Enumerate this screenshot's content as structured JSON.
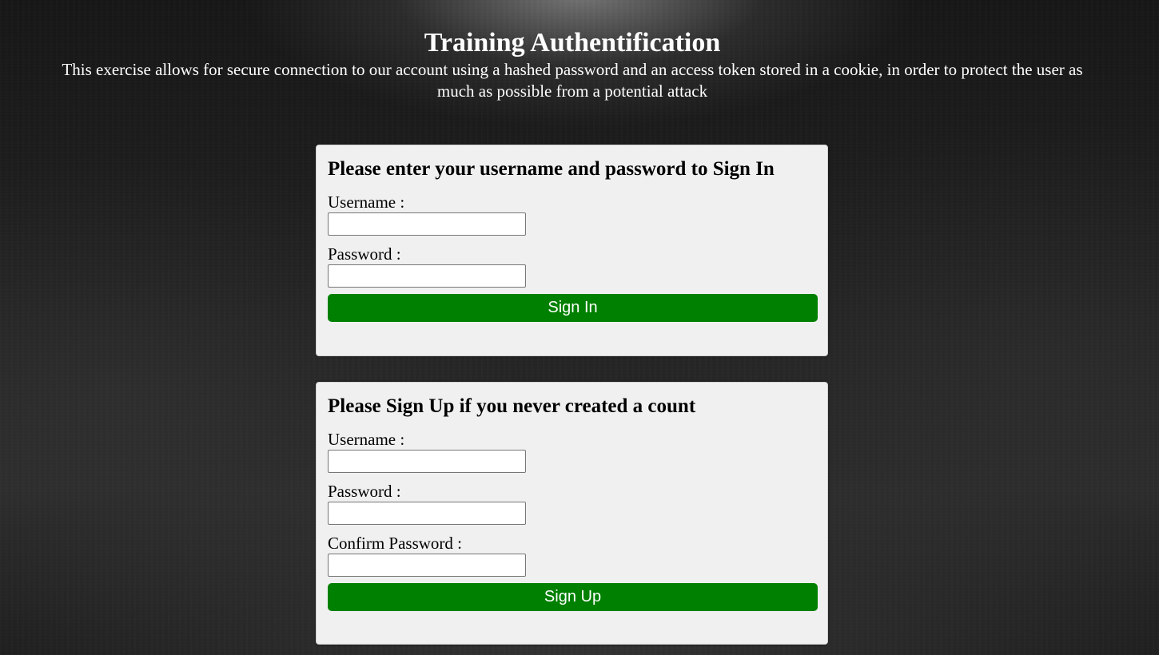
{
  "header": {
    "title": "Training Authentification",
    "subtitle": "This exercise allows for secure connection to our account using a hashed password and an access token stored in a cookie, in order to protect the user as much as possible from a potential attack"
  },
  "signin": {
    "heading": "Please enter your username and password to Sign In",
    "username_label": "Username :",
    "username_value": "",
    "password_label": "Password :",
    "password_value": "",
    "button_label": "Sign In"
  },
  "signup": {
    "heading": "Please Sign Up if you never created a count",
    "username_label": "Username :",
    "username_value": "",
    "password_label": "Password :",
    "password_value": "",
    "confirm_label": "Confirm Password :",
    "confirm_value": "",
    "button_label": "Sign Up"
  },
  "colors": {
    "button_bg": "#008000",
    "card_bg": "#f0f0f0",
    "text_on_dark": "#ffffff"
  }
}
